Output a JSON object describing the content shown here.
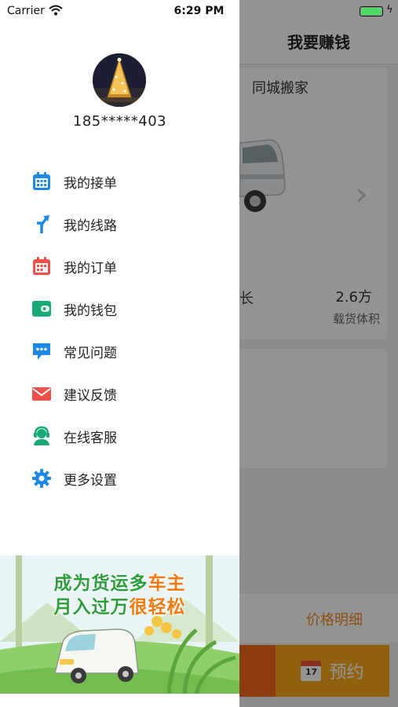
{
  "status_bar": {
    "carrier": "Carrier",
    "time": "6:29 PM"
  },
  "drawer": {
    "phone": "185*****403",
    "menu": [
      {
        "label": "我的接单",
        "icon": "calendar-grid-icon"
      },
      {
        "label": "我的线路",
        "icon": "route-arrow-icon"
      },
      {
        "label": "我的订单",
        "icon": "calendar-icon"
      },
      {
        "label": "我的钱包",
        "icon": "wallet-icon"
      },
      {
        "label": "常见问题",
        "icon": "chat-bubble-icon"
      },
      {
        "label": "建议反馈",
        "icon": "mail-icon"
      },
      {
        "label": "在线客服",
        "icon": "customer-service-icon"
      },
      {
        "label": "更多设置",
        "icon": "gear-icon"
      }
    ],
    "banner": {
      "line1_a": "成为货运多",
      "line1_b": "车主",
      "line2_a": "月入过万",
      "line2_b": "很轻松"
    }
  },
  "main": {
    "title": "我要赚钱",
    "tab": "同城搬家",
    "fragment": "长",
    "volume_value": "2.6方",
    "volume_label": "载货体积",
    "price_detail": "价格明细",
    "book_label": "预约",
    "book_icon_number": "17"
  },
  "colors": {
    "blue": "#1e88e5",
    "red": "#f0504a",
    "green": "#19a974",
    "orange": "#f8a81a"
  }
}
